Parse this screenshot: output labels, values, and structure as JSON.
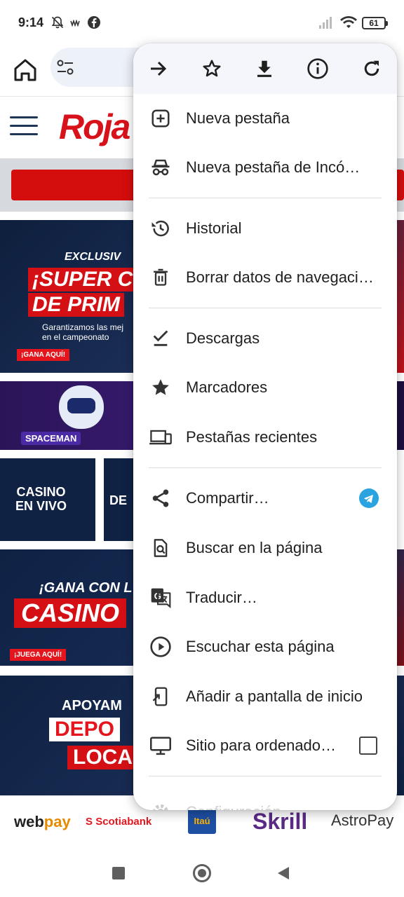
{
  "status_bar": {
    "time": "9:14",
    "battery": "61"
  },
  "site": {
    "logo_text": "Roja",
    "banner1": {
      "kicker": "EXCLUSIV",
      "line1": "¡SUPER CU",
      "line2": "DE PRIM",
      "sub1": "Garantizamos las mej",
      "sub2": "en el campeonato",
      "cta": "¡GANA AQUÍ!"
    },
    "banner2": {
      "tag": "SPACEMAN"
    },
    "tile1": {
      "line1": "CASINO",
      "line2": "EN VIVO"
    },
    "tile2": {
      "text": "DE"
    },
    "banner3": {
      "line1": "¡GANA CON L",
      "line2": "CASINO",
      "cta": "¡JUEGA AQUÍ!"
    },
    "banner4": {
      "line1": "APOYAM",
      "line2": "DEPO",
      "line3": "LOCA"
    }
  },
  "payments": {
    "webpay_a": "web",
    "webpay_b": "pay",
    "scotiabank": "Scotiabank",
    "itau": "Itaú",
    "skrill": "Skrill",
    "astropay": "AstroPay"
  },
  "menu": {
    "top_actions": [
      "forward-icon",
      "bookmark-star-icon",
      "download-icon",
      "info-icon",
      "reload-icon"
    ],
    "items": [
      {
        "label": "Nueva pestaña",
        "icon": "new-tab-icon"
      },
      {
        "label": "Nueva pestaña de Incó…",
        "icon": "incognito-icon"
      },
      {
        "label": "Historial",
        "icon": "history-icon"
      },
      {
        "label": "Borrar datos de navegaci…",
        "icon": "trash-icon"
      },
      {
        "label": "Descargas",
        "icon": "downloads-check-icon"
      },
      {
        "label": "Marcadores",
        "icon": "bookmarks-star-icon"
      },
      {
        "label": "Pestañas recientes",
        "icon": "recent-tabs-icon"
      },
      {
        "label": "Compartir…",
        "icon": "share-icon"
      },
      {
        "label": "Buscar en la página",
        "icon": "find-in-page-icon"
      },
      {
        "label": "Traducir…",
        "icon": "translate-icon"
      },
      {
        "label": "Escuchar esta página",
        "icon": "listen-icon"
      },
      {
        "label": "Añadir a pantalla de inicio",
        "icon": "add-to-home-icon"
      },
      {
        "label": "Sitio para ordenado…",
        "icon": "desktop-site-icon"
      },
      {
        "label": "Configuración",
        "icon": "settings-icon"
      }
    ],
    "desktop_site_checked": false
  },
  "colors": {
    "brand_red": "#d8121a",
    "telegram_blue": "#2aa3e0",
    "menu_top_bg": "#f4f6fb"
  }
}
